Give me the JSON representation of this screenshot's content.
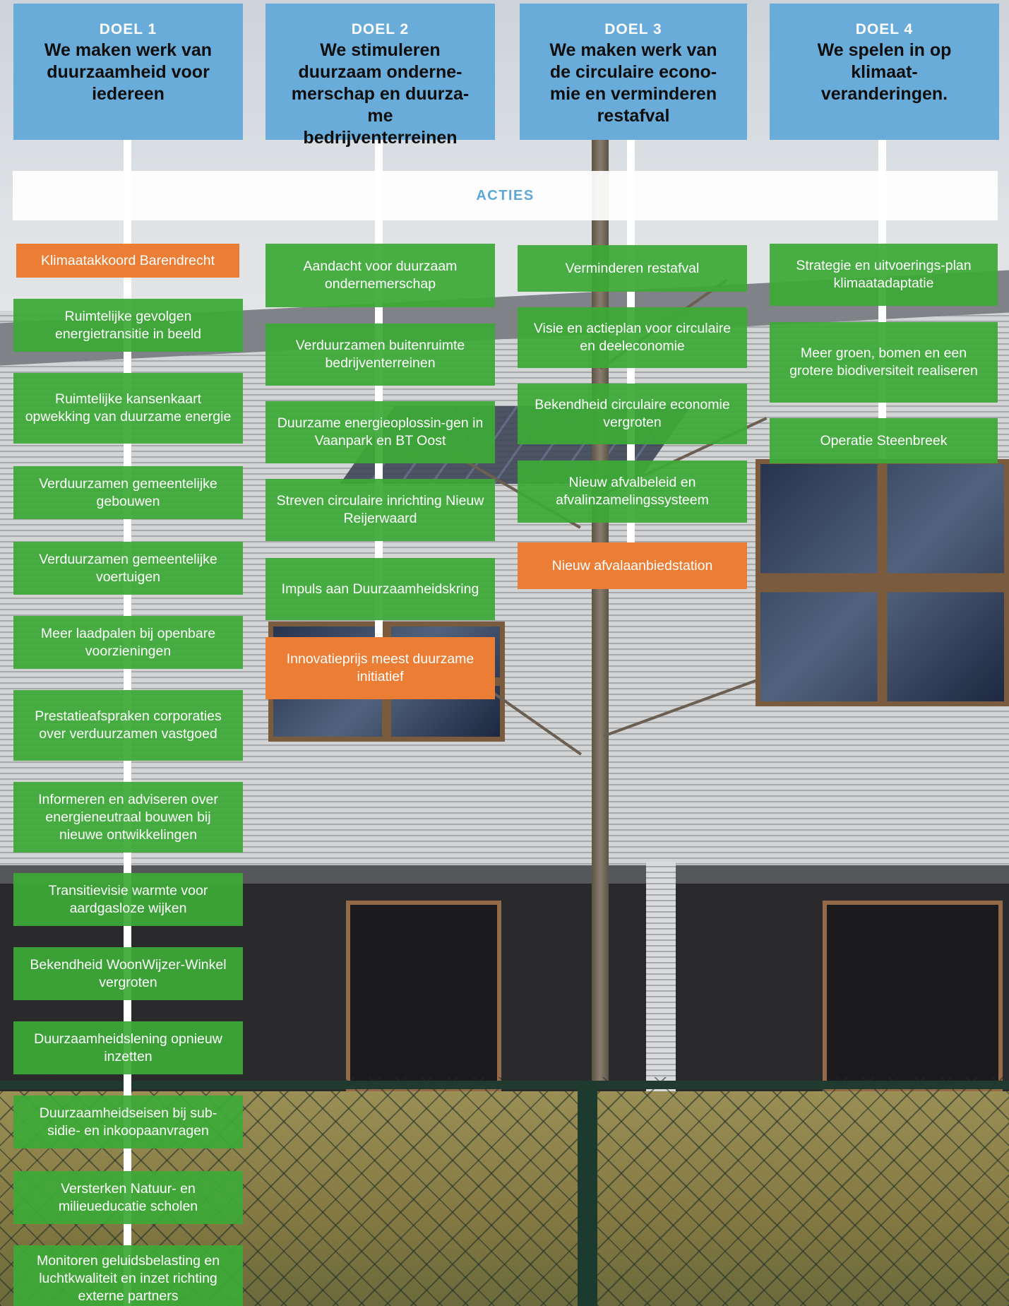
{
  "colors": {
    "goal": "#6aacd9",
    "acties": "#5ea7d6",
    "action_green": "#3caa37",
    "action_orange": "#ec7d35"
  },
  "goals": [
    {
      "number": "DOEL 1",
      "title": "We maken werk van duurzaamheid voor iedereen"
    },
    {
      "number": "DOEL 2",
      "title": "We stimuleren duurzaam onderne-merschap en duurza-me bedrijventerreinen"
    },
    {
      "number": "DOEL 3",
      "title": "We maken werk van de circulaire econo-mie en verminderen restafval"
    },
    {
      "number": "DOEL 4",
      "title": "We spelen in op klimaat-veranderingen."
    }
  ],
  "acties_label": "ACTIES",
  "actions": {
    "goal1": [
      {
        "label": "Klimaatakkoord Barendrecht",
        "color": "orange"
      },
      {
        "label": "Ruimtelijke gevolgen energietransitie in beeld",
        "color": "green"
      },
      {
        "label": "Ruimtelijke kansenkaart opwekking van duurzame energie",
        "color": "green"
      },
      {
        "label": "Verduurzamen gemeentelijke gebouwen",
        "color": "green"
      },
      {
        "label": "Verduurzamen gemeentelijke voertuigen",
        "color": "green"
      },
      {
        "label": "Meer laadpalen bij openbare voorzieningen",
        "color": "green"
      },
      {
        "label": "Prestatieafspraken corporaties over verduurzamen vastgoed",
        "color": "green"
      },
      {
        "label": "Informeren en adviseren over energieneutraal bouwen bij nieuwe ontwikkelingen",
        "color": "green"
      },
      {
        "label": "Transitievisie warmte voor aardgasloze wijken",
        "color": "green"
      },
      {
        "label": "Bekendheid WoonWijzer-Winkel vergroten",
        "color": "green"
      },
      {
        "label": "Duurzaamheidslening opnieuw inzetten",
        "color": "green"
      },
      {
        "label": "Duurzaamheidseisen bij sub-sidie- en inkoopaanvragen",
        "color": "green"
      },
      {
        "label": "Versterken Natuur- en milieueducatie scholen",
        "color": "green"
      },
      {
        "label": "Monitoren geluidsbelasting en luchtkwaliteit en inzet richting externe partners",
        "color": "green"
      }
    ],
    "goal2": [
      {
        "label": "Aandacht voor duurzaam ondernemerschap",
        "color": "green"
      },
      {
        "label": "Verduurzamen buitenruimte bedrijventerreinen",
        "color": "green"
      },
      {
        "label": "Duurzame energieoplossin-gen in Vaanpark en BT Oost",
        "color": "green"
      },
      {
        "label": "Streven circulaire inrichting Nieuw Reijerwaard",
        "color": "green"
      },
      {
        "label": "Impuls aan Duurzaamheidskring",
        "color": "green"
      },
      {
        "label": "Innovatieprijs meest duurzame initiatief",
        "color": "orange"
      }
    ],
    "goal3": [
      {
        "label": "Verminderen restafval",
        "color": "green"
      },
      {
        "label": "Visie en actieplan voor circulaire en deeleconomie",
        "color": "green"
      },
      {
        "label": "Bekendheid circulaire economie vergroten",
        "color": "green"
      },
      {
        "label": "Nieuw afvalbeleid en afvalinzamelingssysteem",
        "color": "green"
      },
      {
        "label": "Nieuw afvalaanbiedstation",
        "color": "orange"
      }
    ],
    "goal4": [
      {
        "label": "Strategie en uitvoerings-plan  klimaatadaptatie",
        "color": "green"
      },
      {
        "label": "Meer groen, bomen en een grotere biodiversiteit realiseren",
        "color": "green"
      },
      {
        "label": "Operatie Steenbreek",
        "color": "green"
      }
    ]
  }
}
